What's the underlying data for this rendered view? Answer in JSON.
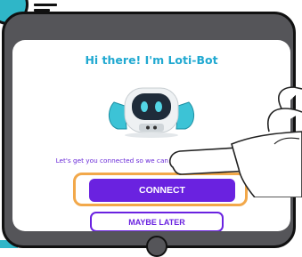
{
  "dialog": {
    "title": "Hi there! I'm Loti-Bot",
    "message": "Let's get you connected so we can learn and play together"
  },
  "buttons": {
    "connect_label": "CONNECT",
    "maybe_later_label": "MAYBE LATER"
  },
  "colors": {
    "title": "#21a9d1",
    "primary": "#6a22e0",
    "highlight_ring": "#f2a84a",
    "tablet_frame": "#555559",
    "accent_teal": "#2fb6c8"
  },
  "icons": [
    "robot-mascot-icon",
    "pointing-hand-icon",
    "home-button-icon"
  ]
}
